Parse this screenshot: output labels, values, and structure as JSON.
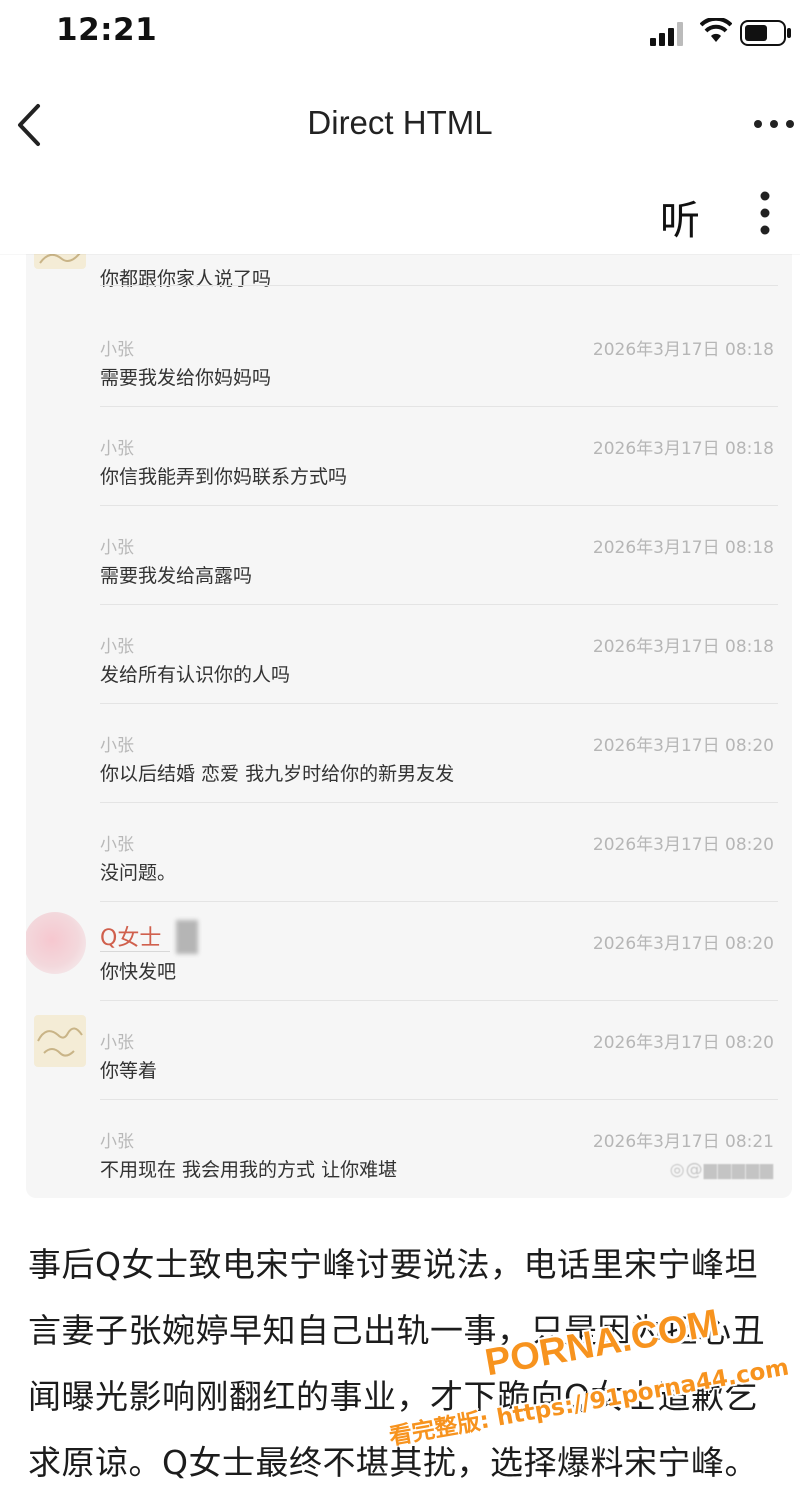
{
  "status_bar": {
    "time": "12:21"
  },
  "nav": {
    "title": "Direct HTML"
  },
  "toolbar": {
    "listen_label": "听"
  },
  "messages": [
    {
      "sender": "",
      "time": "",
      "text": "你都跟你家人说了吗",
      "avatar": "sketch"
    },
    {
      "sender": "小张",
      "time": "2026年3月17日 08:18",
      "text": "需要我发给你妈妈吗"
    },
    {
      "sender": "小张",
      "time": "2026年3月17日 08:18",
      "text": "你信我能弄到你妈联系方式吗"
    },
    {
      "sender": "小张",
      "time": "2026年3月17日 08:18",
      "text": "需要我发给高露吗"
    },
    {
      "sender": "小张",
      "time": "2026年3月17日 08:18",
      "text": "发给所有认识你的人吗"
    },
    {
      "sender": "小张",
      "time": "2026年3月17日 08:20",
      "text": "你以后结婚 恋爱 我九岁时给你的新男友发"
    },
    {
      "sender": "小张",
      "time": "2026年3月17日 08:20",
      "text": "没问题。"
    },
    {
      "sender": "Q女士",
      "time": "2026年3月17日 08:20",
      "text": "你快发吧",
      "avatar": "pink"
    },
    {
      "sender": "小张",
      "time": "2026年3月17日 08:20",
      "text": "你等着",
      "avatar": "sketch"
    },
    {
      "sender": "小张",
      "time": "2026年3月17日 08:21",
      "text": "不用现在 我会用我的方式 让你难堪"
    }
  ],
  "article_lines": [
    "事后Q女士致电宋宁峰讨要说法，电话里宋宁峰坦",
    "言妻子张婉婷早知自己出轨一事，只是因为担心丑",
    "闻曝光影响刚翻红的事业，才下跪向Q女士道歉乞",
    "求原谅。Q女士最终不堪其扰，选择爆料宋宁峰。"
  ],
  "watermarks": {
    "logo": "PORNA.COM",
    "url_line": "看完整版: https://91porna44.com"
  },
  "colors": {
    "watermark": "#f7931e",
    "highlight_name": "#d0604d"
  }
}
